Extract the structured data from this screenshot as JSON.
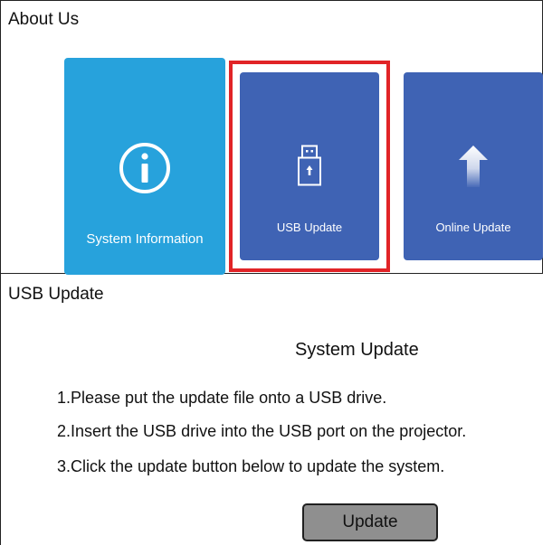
{
  "about": {
    "title": "About Us",
    "tiles": [
      {
        "label": "System Information",
        "icon": "info-icon",
        "color": "#27a2dc"
      },
      {
        "label": "USB Update",
        "icon": "usb-drive-icon",
        "color": "#3f63b4",
        "selected": true
      },
      {
        "label": "Online Update",
        "icon": "upload-arrow-icon",
        "color": "#3f63b4"
      }
    ],
    "selection_color": "#e12427"
  },
  "usb_update": {
    "title": "USB Update",
    "dialog_title": "System Update",
    "instructions": [
      "1.Please put the update file onto a USB drive.",
      "2.Insert the USB drive into the USB port on the projector.",
      "3.Click the update button below to update the system."
    ],
    "button_label": "Update"
  }
}
